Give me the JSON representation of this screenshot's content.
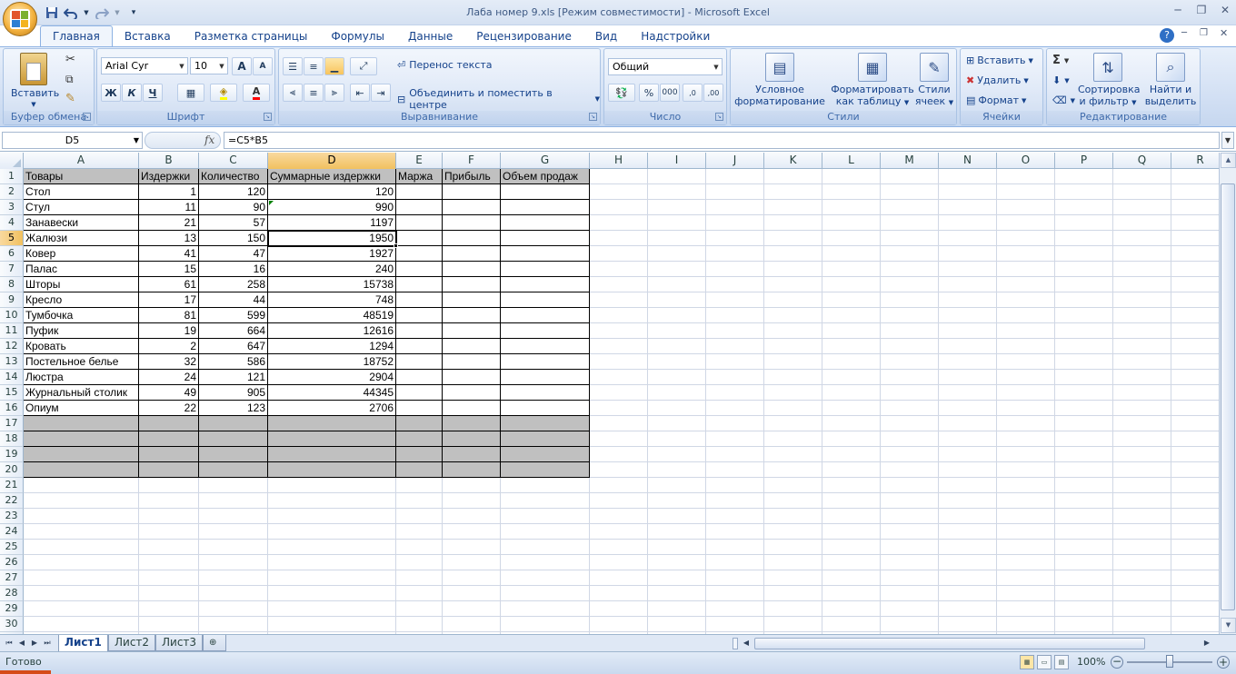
{
  "window": {
    "title": "Лаба номер 9.xls  [Режим совместимости] - Microsoft Excel"
  },
  "tabs": [
    "Главная",
    "Вставка",
    "Разметка страницы",
    "Формулы",
    "Данные",
    "Рецензирование",
    "Вид",
    "Надстройки"
  ],
  "ribbon": {
    "clipboard": {
      "label": "Буфер обмена",
      "paste": "Вставить"
    },
    "font": {
      "label": "Шрифт",
      "name": "Arial Cyr",
      "size": "10",
      "bold": "Ж",
      "italic": "К",
      "underline": "Ч",
      "grow": "A",
      "color": "A"
    },
    "alignment": {
      "label": "Выравнивание",
      "wrap": "Перенос текста",
      "merge": "Объединить и поместить в центре"
    },
    "number": {
      "label": "Число",
      "format": "Общий",
      "percent": "%",
      "thousands": "000",
      "inc_decimal": ",0",
      "dec_decimal": ",00"
    },
    "styles": {
      "label": "Стили",
      "conditional_1": "Условное",
      "conditional_2": "форматирование",
      "table_1": "Форматировать",
      "table_2": "как таблицу",
      "cell_1": "Стили",
      "cell_2": "ячеек"
    },
    "cells": {
      "label": "Ячейки",
      "insert": "Вставить",
      "delete": "Удалить",
      "format": "Формат"
    },
    "editing": {
      "label": "Редактирование",
      "sigma": "Σ",
      "sort_1": "Сортировка",
      "sort_2": "и фильтр",
      "find_1": "Найти и",
      "find_2": "выделить"
    }
  },
  "formula_bar": {
    "name_box": "D5",
    "fx": "fx",
    "formula": "=C5*B5"
  },
  "columns": [
    "A",
    "B",
    "C",
    "D",
    "E",
    "F",
    "G",
    "H",
    "I",
    "J",
    "K",
    "L",
    "M",
    "N",
    "O",
    "P",
    "Q",
    "R"
  ],
  "sheet": {
    "header": [
      "Товары",
      "Издержки",
      "Количество",
      "Суммарные издержки",
      "Маржа",
      "Прибыль",
      "Объем продаж"
    ],
    "rows": [
      [
        "Стол",
        "1",
        "120",
        "120"
      ],
      [
        "Стул",
        "11",
        "90",
        "990"
      ],
      [
        "Занавески",
        "21",
        "57",
        "1197"
      ],
      [
        "Жалюзи",
        "13",
        "150",
        "1950"
      ],
      [
        "Ковер",
        "41",
        "47",
        "1927"
      ],
      [
        "Палас",
        "15",
        "16",
        "240"
      ],
      [
        "Шторы",
        "61",
        "258",
        "15738"
      ],
      [
        "Кресло",
        "17",
        "44",
        "748"
      ],
      [
        "Тумбочка",
        "81",
        "599",
        "48519"
      ],
      [
        "Пуфик",
        "19",
        "664",
        "12616"
      ],
      [
        "Кровать",
        "2",
        "647",
        "1294"
      ],
      [
        "Постельное белье",
        "32",
        "586",
        "18752"
      ],
      [
        "Люстра",
        "24",
        "121",
        "2904"
      ],
      [
        "Журнальный столик",
        "49",
        "905",
        "44345"
      ],
      [
        "Опиум",
        "22",
        "123",
        "2706"
      ]
    ],
    "selected_cell": "D5"
  },
  "sheet_tabs": [
    "Лист1",
    "Лист2",
    "Лист3"
  ],
  "status": {
    "ready": "Готово",
    "zoom": "100%"
  }
}
